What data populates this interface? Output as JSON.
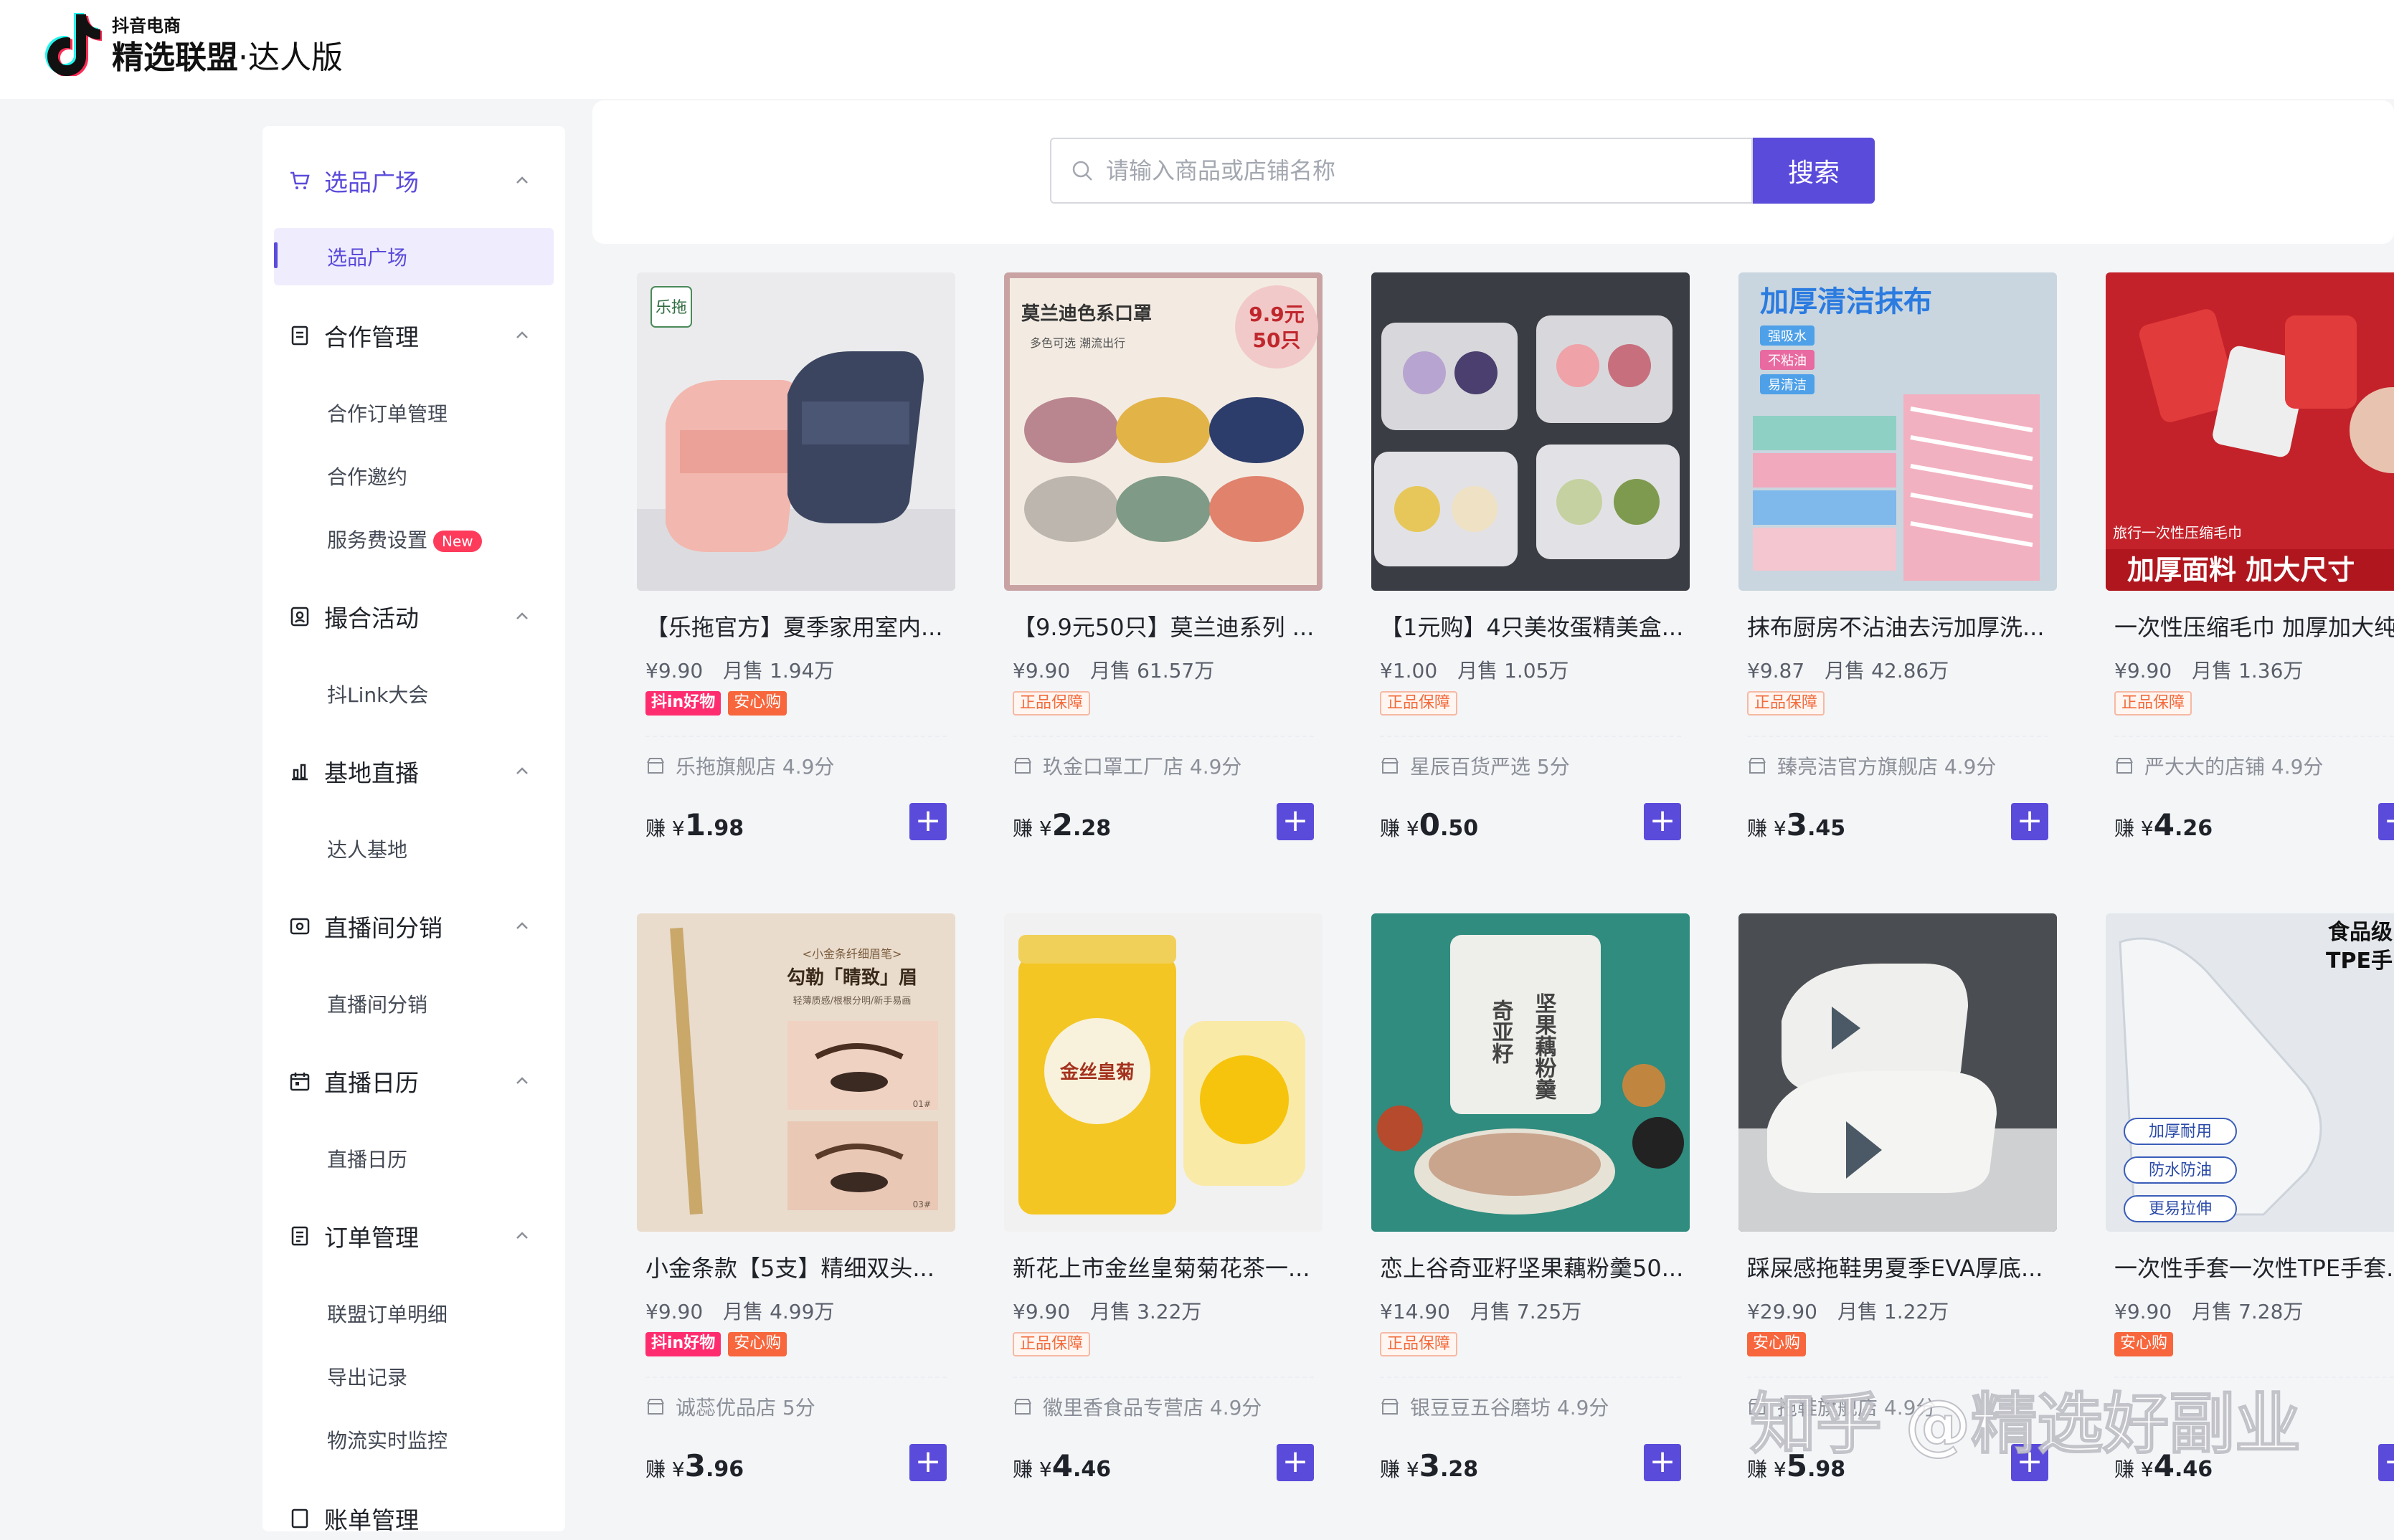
{
  "header": {
    "brand_small": "抖音电商",
    "brand_main": "精选联盟",
    "brand_suffix": "·达人版"
  },
  "sidebar": {
    "groups": [
      {
        "label": "选品广场",
        "icon": "cart-icon",
        "items": [
          {
            "label": "选品广场"
          }
        ]
      },
      {
        "label": "合作管理",
        "icon": "document-icon",
        "items": [
          {
            "label": "合作订单管理"
          },
          {
            "label": "合作邀约"
          },
          {
            "label": "服务费设置",
            "badge": "New"
          }
        ]
      },
      {
        "label": "撮合活动",
        "icon": "handshake-icon",
        "items": [
          {
            "label": "抖Link大会"
          }
        ]
      },
      {
        "label": "基地直播",
        "icon": "chart-icon",
        "items": [
          {
            "label": "达人基地"
          }
        ]
      },
      {
        "label": "直播间分销",
        "icon": "live-icon",
        "items": [
          {
            "label": "直播间分销"
          }
        ]
      },
      {
        "label": "直播日历",
        "icon": "calendar-icon",
        "items": [
          {
            "label": "直播日历"
          }
        ]
      },
      {
        "label": "订单管理",
        "icon": "order-icon",
        "items": [
          {
            "label": "联盟订单明细"
          },
          {
            "label": "导出记录"
          },
          {
            "label": "物流实时监控"
          }
        ]
      },
      {
        "label": "账单管理",
        "icon": "bill-icon",
        "items": []
      }
    ]
  },
  "search": {
    "placeholder": "请输入商品或店铺名称",
    "button_label": "搜索"
  },
  "products": [
    {
      "title": "【乐拖官方】夏季家用室内...",
      "price": "¥9.90",
      "sales": "月售 1.94万",
      "tags": [
        "抖in好物",
        "安心购"
      ],
      "shop": "乐拖旗舰店 4.9分",
      "earn_int": "1",
      "earn_dec": ".98"
    },
    {
      "title": "【9.9元50只】莫兰迪系列 ...",
      "price": "¥9.90",
      "sales": "月售 61.57万",
      "tags": [
        "正品保障"
      ],
      "shop": "玖金口罩工厂店 4.9分",
      "earn_int": "2",
      "earn_dec": ".28"
    },
    {
      "title": "【1元购】4只美妆蛋精美盒...",
      "price": "¥1.00",
      "sales": "月售 1.05万",
      "tags": [
        "正品保障"
      ],
      "shop": "星辰百货严选 5分",
      "earn_int": "0",
      "earn_dec": ".50"
    },
    {
      "title": "抹布厨房不沾油去污加厚洗...",
      "price": "¥9.87",
      "sales": "月售 42.86万",
      "tags": [
        "正品保障"
      ],
      "shop": "臻亮洁官方旗舰店 4.9分",
      "earn_int": "3",
      "earn_dec": ".45"
    },
    {
      "title": "一次性压缩毛巾 加厚加大纯",
      "price": "¥9.90",
      "sales": "月售 1.36万",
      "tags": [
        "正品保障"
      ],
      "shop": "严大大的店铺 4.9分",
      "earn_int": "4",
      "earn_dec": ".26"
    },
    {
      "title": "小金条款【5支】精细双头...",
      "price": "¥9.90",
      "sales": "月售 4.99万",
      "tags": [
        "抖in好物",
        "安心购"
      ],
      "shop": "诚蕊优品店 5分",
      "earn_int": "3",
      "earn_dec": ".96"
    },
    {
      "title": "新花上市金丝皇菊菊花茶一...",
      "price": "¥9.90",
      "sales": "月售 3.22万",
      "tags": [
        "正品保障"
      ],
      "shop": "徽里香食品专营店 4.9分",
      "earn_int": "4",
      "earn_dec": ".46"
    },
    {
      "title": "恋上谷奇亚籽坚果藕粉羹50...",
      "price": "¥14.90",
      "sales": "月售 7.25万",
      "tags": [
        "正品保障"
      ],
      "shop": "银豆豆五谷磨坊 4.9分",
      "earn_int": "3",
      "earn_dec": ".28"
    },
    {
      "title": "踩屎感拖鞋男夏季EVA厚底...",
      "price": "¥29.90",
      "sales": "月售 1.22万",
      "tags": [
        "安心购"
      ],
      "shop": "拖鞋旗舰店 4.9分",
      "earn_int": "5",
      "earn_dec": ".98"
    },
    {
      "title": "一次性手套一次性TPE手套...",
      "price": "¥9.90",
      "sales": "月售 7.28万",
      "tags": [
        "安心购"
      ],
      "shop": "",
      "earn_int": "4",
      "earn_dec": ".46"
    }
  ],
  "earn_prefix": "赚 ¥",
  "image_text": {
    "p1_logo": "乐拖",
    "p2_headline": "莫兰迪色系口罩",
    "p2_sub": "多色可选   潮流出行",
    "p2_price1": "9.9元",
    "p2_price2": "50只",
    "p4_headline": "加厚清洁抹布",
    "p4_tags": [
      "强吸水",
      "不粘油",
      "易清洁"
    ],
    "p5_sub": "旅行一次性压缩毛巾",
    "p5_headline": "加厚面料 加大尺寸",
    "p6_top": "<小金条纤细眉笔>",
    "p6_headline": "勾勒「睛致」眉",
    "p6_sub": "轻薄质感/根根分明/新手易画",
    "p6_code1": "01#",
    "p6_code2": "03#",
    "p7_label": "金丝皇菊",
    "p8_label": "坚果藕粉羹",
    "p8_label2": "奇亚籽",
    "p10_head1": "食品级",
    "p10_head2": "TPE手",
    "p10_tags": [
      "加厚耐用",
      "防水防油",
      "更易拉伸"
    ]
  },
  "watermark": "知乎 @精选好副业",
  "colors": {
    "accent": "#5b4bdb",
    "tag_pink": "#ff2d6f",
    "tag_orange": "#f7663c"
  }
}
